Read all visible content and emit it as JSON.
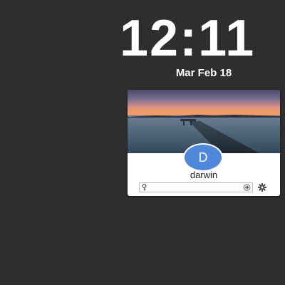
{
  "clock": {
    "time": "12:11",
    "date": "Mar Feb 18"
  },
  "user_card": {
    "avatar_initial": "D",
    "username": "darwin",
    "avatar_color": "#4f87d9"
  },
  "password": {
    "value": "",
    "placeholder": ""
  },
  "icons": {
    "password_field": "key-icon",
    "submit": "arrow-right-circle-icon",
    "settings": "gear-icon"
  },
  "colors": {
    "background": "#2e2e2e",
    "card": "#ffffff",
    "text": "#ffffff"
  }
}
